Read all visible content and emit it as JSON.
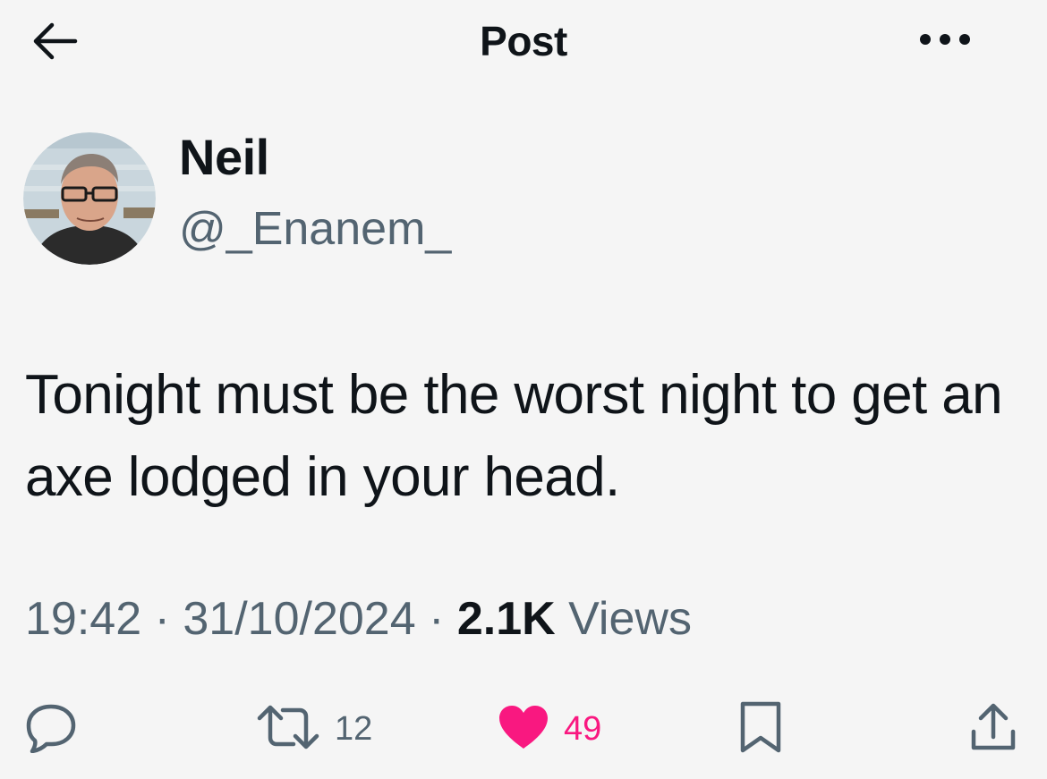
{
  "header": {
    "title": "Post",
    "back_icon": "arrow-left-icon",
    "more_icon": "more-horizontal-icon"
  },
  "author": {
    "display_name": "Neil",
    "handle": "@_Enanem_",
    "avatar_icon": "profile-photo"
  },
  "tweet": {
    "text": "Tonight must be the worst night to get an axe lodged in your head."
  },
  "meta": {
    "time": "19:42",
    "separator": "·",
    "date": "31/10/2024",
    "views_count": "2.1K",
    "views_label": "Views"
  },
  "actions": {
    "reply_icon": "reply-bubble-icon",
    "retweet_icon": "retweet-icon",
    "retweet_count": "12",
    "like_icon": "heart-icon",
    "like_count": "49",
    "like_active": true,
    "bookmark_icon": "bookmark-icon",
    "share_icon": "share-icon"
  },
  "colors": {
    "background": "#f5f5f5",
    "text_primary": "#0f1419",
    "text_secondary": "#536471",
    "like_pink": "#f91880"
  }
}
